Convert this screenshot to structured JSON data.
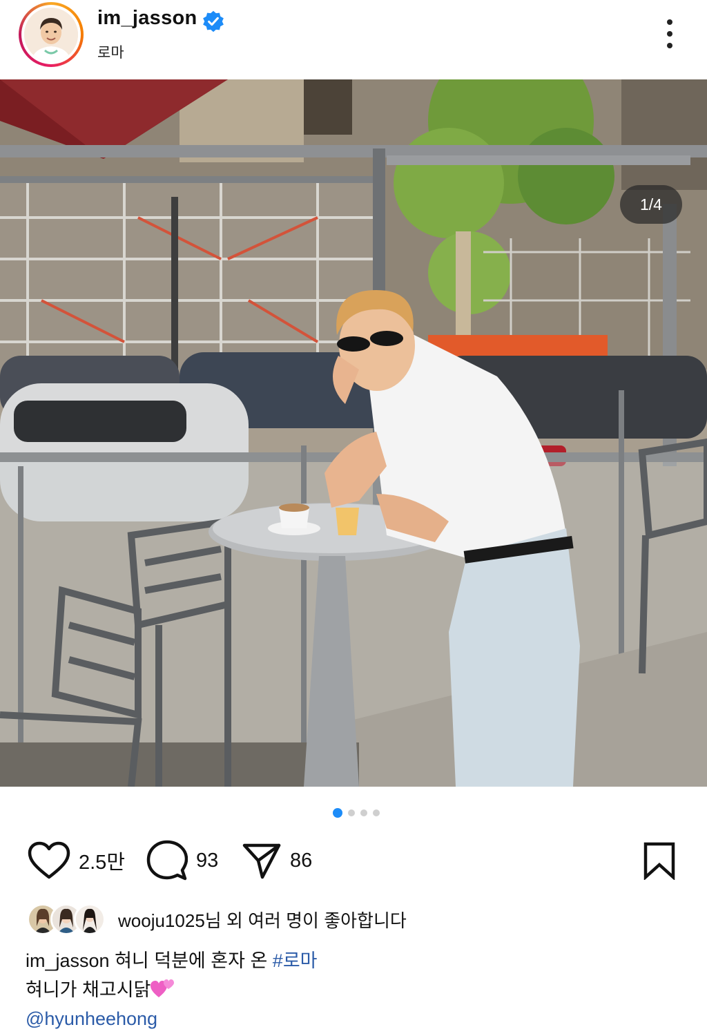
{
  "post": {
    "username": "im_jasson",
    "location": "로마",
    "carousel_counter": "1/4",
    "carousel_pages": 4,
    "carousel_current": 1
  },
  "actions": {
    "likes_count": "2.5만",
    "comments_count": "93",
    "shares_count": "86"
  },
  "likes_summary": {
    "text_user": "wooju1025",
    "text_rest": "님 외 여러 명이 좋아합니다"
  },
  "caption": {
    "username": "im_jasson",
    "line1_text": " 혀니 덕분에 혼자 온 ",
    "hashtag": "#로마",
    "line2_text": "혀니가 채고시닭",
    "mention": "@hyunheehong"
  },
  "colors": {
    "verified": "#1d8cf8",
    "active_dot": "#1d8cf8",
    "link": "#2b5ba8"
  },
  "icons": {
    "verified": "verified-badge-icon",
    "more": "more-vertical-icon",
    "like": "heart-outline-icon",
    "comment": "comment-bubble-icon",
    "share": "paper-plane-icon",
    "save": "bookmark-outline-icon"
  }
}
